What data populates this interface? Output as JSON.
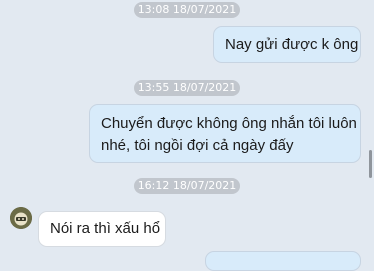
{
  "conversation": {
    "messages": [
      {
        "type": "timestamp",
        "text": "13:08 18/07/2021"
      },
      {
        "type": "outgoing",
        "lines": [
          "Nay gửi được k ông"
        ]
      },
      {
        "type": "timestamp",
        "text": "13:55 18/07/2021"
      },
      {
        "type": "outgoing",
        "lines": [
          "Chuyển được không ông nhắn tôi luôn",
          "nhé, tôi ngồi đợi cả ngày đấy"
        ]
      },
      {
        "type": "timestamp",
        "text": "16:12 18/07/2021"
      },
      {
        "type": "incoming",
        "lines": [
          "Nói ra thì xấu hổ"
        ]
      }
    ]
  },
  "colors": {
    "background": "#e2e9f1",
    "outgoing_bubble": "#d8ebfa",
    "incoming_bubble": "#ffffff",
    "timestamp_pill": "#c1c6cd"
  },
  "icons": {
    "avatar": "sender-avatar-icon"
  }
}
